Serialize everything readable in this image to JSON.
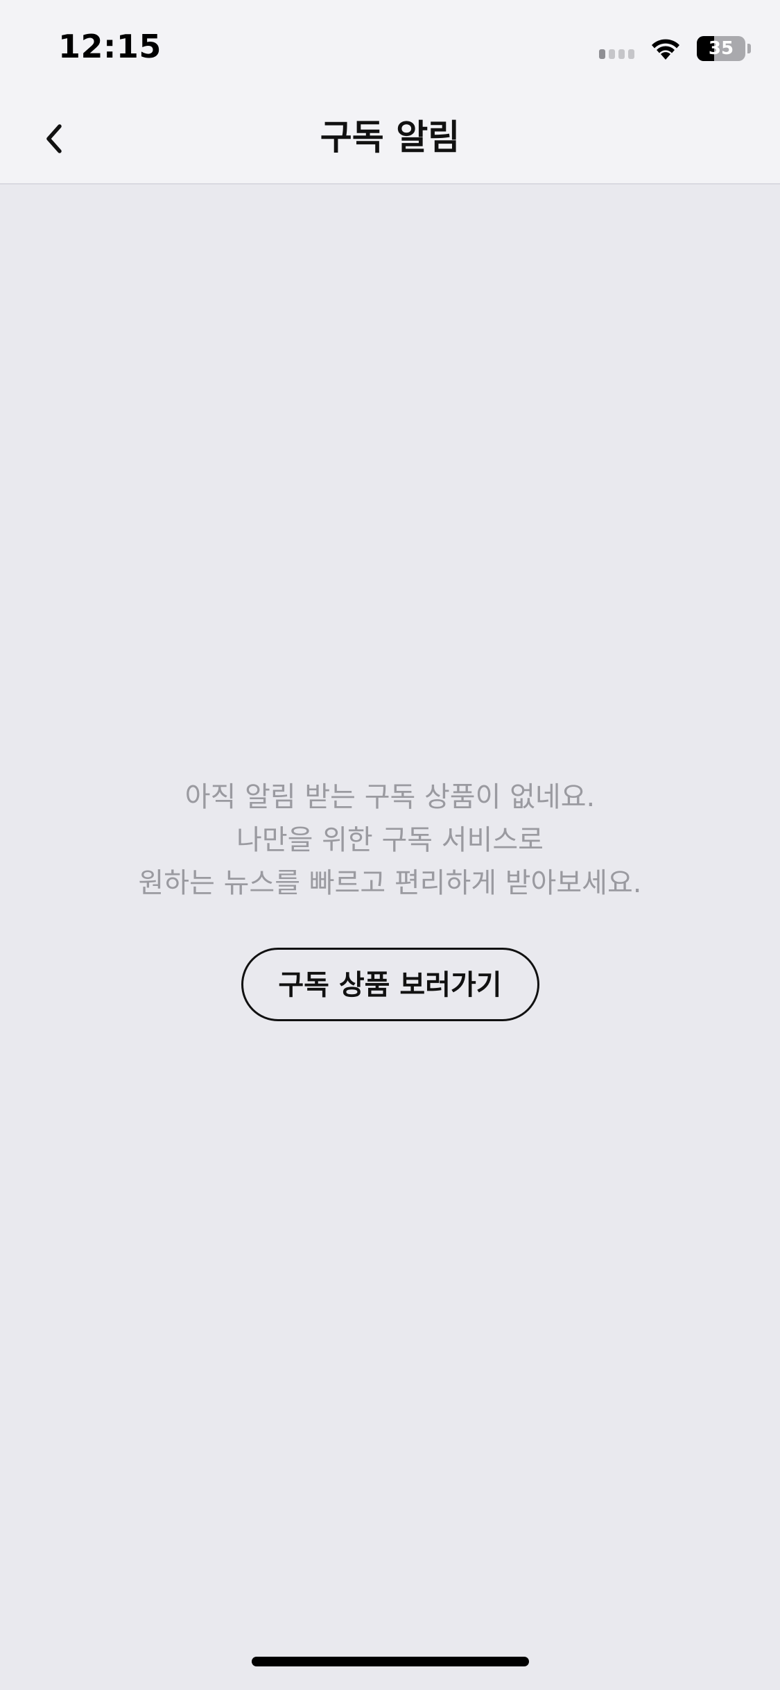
{
  "status_bar": {
    "time": "12:15",
    "battery_level": "35",
    "battery_fraction": 0.35,
    "signal_bars_active": 1,
    "signal_bars_total": 4
  },
  "nav": {
    "title": "구독 알림",
    "back_icon": "chevron-left-icon"
  },
  "empty_state": {
    "lines": [
      "아직 알림 받는 구독 상품이 없네요.",
      "나만을 위한 구독 서비스로",
      "원하는 뉴스를 빠르고 편리하게 받아보세요."
    ],
    "button_label": "구독 상품 보러가기"
  },
  "colors": {
    "background": "#e9e9ee",
    "header_background": "#f3f3f6",
    "message_text": "#9a9aa0",
    "primary_text": "#111111"
  }
}
